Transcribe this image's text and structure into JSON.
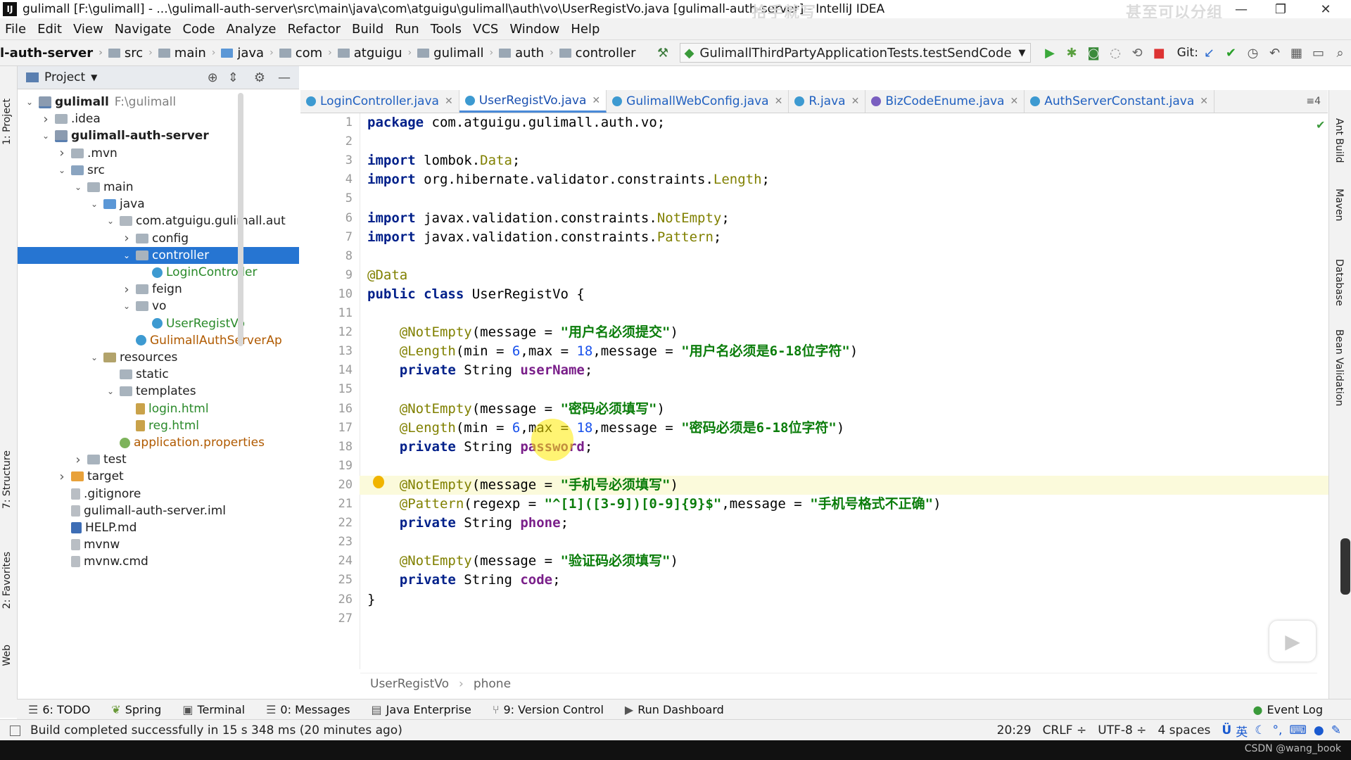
{
  "window": {
    "title": "gulimall [F:\\gulimall] - ...\\gulimall-auth-server\\src\\main\\java\\com\\atguigu\\gulimall\\auth\\vo\\UserRegistVo.java [gulimall-auth-server] - IntelliJ IDEA",
    "app_icon": "IJ",
    "overlay_1": "拾手就写",
    "overlay_2": "甚至可以分组"
  },
  "menu": [
    "File",
    "Edit",
    "View",
    "Navigate",
    "Code",
    "Analyze",
    "Refactor",
    "Build",
    "Run",
    "Tools",
    "VCS",
    "Window",
    "Help"
  ],
  "navbar": {
    "crumbs": [
      "l-auth-server",
      "src",
      "main",
      "java",
      "com",
      "atguigu",
      "gulimall",
      "auth",
      "controller"
    ],
    "run_config": "GulimallThirdPartyApplicationTests.testSendCode",
    "git_label": "Git:"
  },
  "project_panel": {
    "title": "Project",
    "tree": [
      {
        "name": "gulimall",
        "extra": "F:\\gulimall",
        "depth": 0,
        "arrow": "down",
        "icon": "module",
        "style": "bold"
      },
      {
        "name": ".idea",
        "depth": 1,
        "arrow": "right",
        "icon": "folder"
      },
      {
        "name": "gulimall-auth-server",
        "depth": 1,
        "arrow": "down",
        "icon": "module",
        "style": "bold"
      },
      {
        "name": ".mvn",
        "depth": 2,
        "arrow": "right",
        "icon": "folder"
      },
      {
        "name": "src",
        "depth": 2,
        "arrow": "down",
        "icon": "folder src"
      },
      {
        "name": "main",
        "depth": 3,
        "arrow": "down",
        "icon": "folder"
      },
      {
        "name": "java",
        "depth": 4,
        "arrow": "down",
        "icon": "folder java"
      },
      {
        "name": "com.atguigu.gulimall.aut",
        "depth": 5,
        "arrow": "down",
        "icon": "pkg"
      },
      {
        "name": "config",
        "depth": 6,
        "arrow": "right",
        "icon": "folder"
      },
      {
        "name": "controller",
        "depth": 6,
        "arrow": "down",
        "icon": "folder",
        "selected": true
      },
      {
        "name": "LoginController",
        "depth": 7,
        "arrow": "",
        "icon": "class",
        "style": "green"
      },
      {
        "name": "feign",
        "depth": 6,
        "arrow": "right",
        "icon": "folder"
      },
      {
        "name": "vo",
        "depth": 6,
        "arrow": "down",
        "icon": "folder"
      },
      {
        "name": "UserRegistVo",
        "depth": 7,
        "arrow": "",
        "icon": "class",
        "style": "green"
      },
      {
        "name": "GulimallAuthServerAp",
        "depth": 6,
        "arrow": "",
        "icon": "class",
        "style": "orange"
      },
      {
        "name": "resources",
        "depth": 4,
        "arrow": "down",
        "icon": "folder res"
      },
      {
        "name": "static",
        "depth": 5,
        "arrow": "",
        "icon": "folder"
      },
      {
        "name": "templates",
        "depth": 5,
        "arrow": "down",
        "icon": "folder"
      },
      {
        "name": "login.html",
        "depth": 6,
        "arrow": "",
        "icon": "html",
        "style": "green"
      },
      {
        "name": "reg.html",
        "depth": 6,
        "arrow": "",
        "icon": "html",
        "style": "green"
      },
      {
        "name": "application.properties",
        "depth": 5,
        "arrow": "",
        "icon": "props",
        "style": "orange"
      },
      {
        "name": "test",
        "depth": 3,
        "arrow": "right",
        "icon": "folder"
      },
      {
        "name": "target",
        "depth": 2,
        "arrow": "right",
        "icon": "folder target"
      },
      {
        "name": ".gitignore",
        "depth": 2,
        "arrow": "",
        "icon": "file",
        "style": "gray-file"
      },
      {
        "name": "gulimall-auth-server.iml",
        "depth": 2,
        "arrow": "",
        "icon": "file",
        "style": "gray-file"
      },
      {
        "name": "HELP.md",
        "depth": 2,
        "arrow": "",
        "icon": "md",
        "style": "gray-file"
      },
      {
        "name": "mvnw",
        "depth": 2,
        "arrow": "",
        "icon": "file"
      },
      {
        "name": "mvnw.cmd",
        "depth": 2,
        "arrow": "",
        "icon": "file"
      }
    ]
  },
  "left_tabs": {
    "project": "1: Project",
    "structure": "7: Structure",
    "favorites": "2: Favorites",
    "web": "Web"
  },
  "right_tabs": {
    "ant": "Ant Build",
    "maven": "Maven",
    "database": "Database",
    "bean": "Bean Validation"
  },
  "tabs": [
    {
      "label": "LoginController.java",
      "icon": "c"
    },
    {
      "label": "UserRegistVo.java",
      "icon": "c",
      "active": true
    },
    {
      "label": "GulimallWebConfig.java",
      "icon": "c"
    },
    {
      "label": "R.java",
      "icon": "c"
    },
    {
      "label": "BizCodeEnume.java",
      "icon": "e"
    },
    {
      "label": "AuthServerConstant.java",
      "icon": "c"
    }
  ],
  "tab_overflow": "≡4",
  "code_lines": [
    [
      [
        "kw",
        "package"
      ],
      [
        "t",
        " com.atguigu.gulimall.auth.vo;"
      ]
    ],
    [],
    [
      [
        "kw",
        "import"
      ],
      [
        "t",
        " lombok."
      ],
      [
        "ref",
        "Data"
      ],
      [
        "t",
        ";"
      ]
    ],
    [
      [
        "kw",
        "import"
      ],
      [
        "t",
        " org.hibernate.validator.constraints."
      ],
      [
        "ref",
        "Length"
      ],
      [
        "t",
        ";"
      ]
    ],
    [],
    [
      [
        "kw",
        "import"
      ],
      [
        "t",
        " javax.validation.constraints."
      ],
      [
        "ref",
        "NotEmpty"
      ],
      [
        "t",
        ";"
      ]
    ],
    [
      [
        "kw",
        "import"
      ],
      [
        "t",
        " javax.validation.constraints."
      ],
      [
        "ref",
        "Pattern"
      ],
      [
        "t",
        ";"
      ]
    ],
    [],
    [
      [
        "ann",
        "@Data"
      ]
    ],
    [
      [
        "kw",
        "public class"
      ],
      [
        "t",
        " UserRegistVo {"
      ]
    ],
    [],
    [
      [
        "t",
        "    "
      ],
      [
        "ann",
        "@NotEmpty"
      ],
      [
        "t",
        "(message = "
      ],
      [
        "str",
        "\"用户名必须提交\""
      ],
      [
        "t",
        ")"
      ]
    ],
    [
      [
        "t",
        "    "
      ],
      [
        "ann",
        "@Length"
      ],
      [
        "t",
        "(min = "
      ],
      [
        "num",
        "6"
      ],
      [
        "t",
        ",max = "
      ],
      [
        "num",
        "18"
      ],
      [
        "t",
        ",message = "
      ],
      [
        "str",
        "\"用户名必须是6-18位字符\""
      ],
      [
        "t",
        ")"
      ]
    ],
    [
      [
        "t",
        "    "
      ],
      [
        "kw",
        "private"
      ],
      [
        "t",
        " String "
      ],
      [
        "fld",
        "userName"
      ],
      [
        "t",
        ";"
      ]
    ],
    [],
    [
      [
        "t",
        "    "
      ],
      [
        "ann",
        "@NotEmpty"
      ],
      [
        "t",
        "(message = "
      ],
      [
        "str",
        "\"密码必须填写\""
      ],
      [
        "t",
        ")"
      ]
    ],
    [
      [
        "t",
        "    "
      ],
      [
        "ann",
        "@Length"
      ],
      [
        "t",
        "(min = "
      ],
      [
        "num",
        "6"
      ],
      [
        "t",
        ",max = "
      ],
      [
        "num",
        "18"
      ],
      [
        "t",
        ",message = "
      ],
      [
        "str",
        "\"密码必须是6-18位字符\""
      ],
      [
        "t",
        ")"
      ]
    ],
    [
      [
        "t",
        "    "
      ],
      [
        "kw",
        "private"
      ],
      [
        "t",
        " String "
      ],
      [
        "fld",
        "password"
      ],
      [
        "t",
        ";"
      ]
    ],
    [],
    [
      [
        "t",
        "    "
      ],
      [
        "ann",
        "@NotEmpty"
      ],
      [
        "t",
        "(message = "
      ],
      [
        "str",
        "\"手机号必须填写\""
      ],
      [
        "t",
        ")"
      ]
    ],
    [
      [
        "t",
        "    "
      ],
      [
        "ann",
        "@Pattern"
      ],
      [
        "t",
        "(regexp = "
      ],
      [
        "str",
        "\"^[1]([3-9])[0-9]{9}$\""
      ],
      [
        "t",
        ",message = "
      ],
      [
        "str",
        "\"手机号格式不正确\""
      ],
      [
        "t",
        ")"
      ]
    ],
    [
      [
        "t",
        "    "
      ],
      [
        "kw",
        "private"
      ],
      [
        "t",
        " String "
      ],
      [
        "fld",
        "phone"
      ],
      [
        "t",
        ";"
      ]
    ],
    [],
    [
      [
        "t",
        "    "
      ],
      [
        "ann",
        "@NotEmpty"
      ],
      [
        "t",
        "(message = "
      ],
      [
        "str",
        "\"验证码必须填写\""
      ],
      [
        "t",
        ")"
      ]
    ],
    [
      [
        "t",
        "    "
      ],
      [
        "kw",
        "private"
      ],
      [
        "t",
        " String "
      ],
      [
        "fld",
        "code"
      ],
      [
        "t",
        ";"
      ]
    ],
    [
      [
        "t",
        "}"
      ]
    ],
    []
  ],
  "highlighted_line": 20,
  "breadcrumb": {
    "class": "UserRegistVo",
    "member": "phone"
  },
  "tool_windows": [
    {
      "icon": "☰",
      "label": "6: TODO"
    },
    {
      "icon": "❦",
      "label": "Spring"
    },
    {
      "icon": "▣",
      "label": "Terminal"
    },
    {
      "icon": "☰",
      "label": "0: Messages"
    },
    {
      "icon": "▤",
      "label": "Java Enterprise"
    },
    {
      "icon": "⑂",
      "label": "9: Version Control"
    },
    {
      "icon": "▶",
      "label": "Run Dashboard"
    }
  ],
  "event_log": "Event Log",
  "status": {
    "message": "Build completed successfully in 15 s 348 ms (20 minutes ago)",
    "position": "20:29",
    "line_sep": "CRLF ÷",
    "encoding": "UTF-8 ÷",
    "indent": "4 spaces",
    "ime": "英",
    "watermark": "CSDN @wang_book"
  }
}
